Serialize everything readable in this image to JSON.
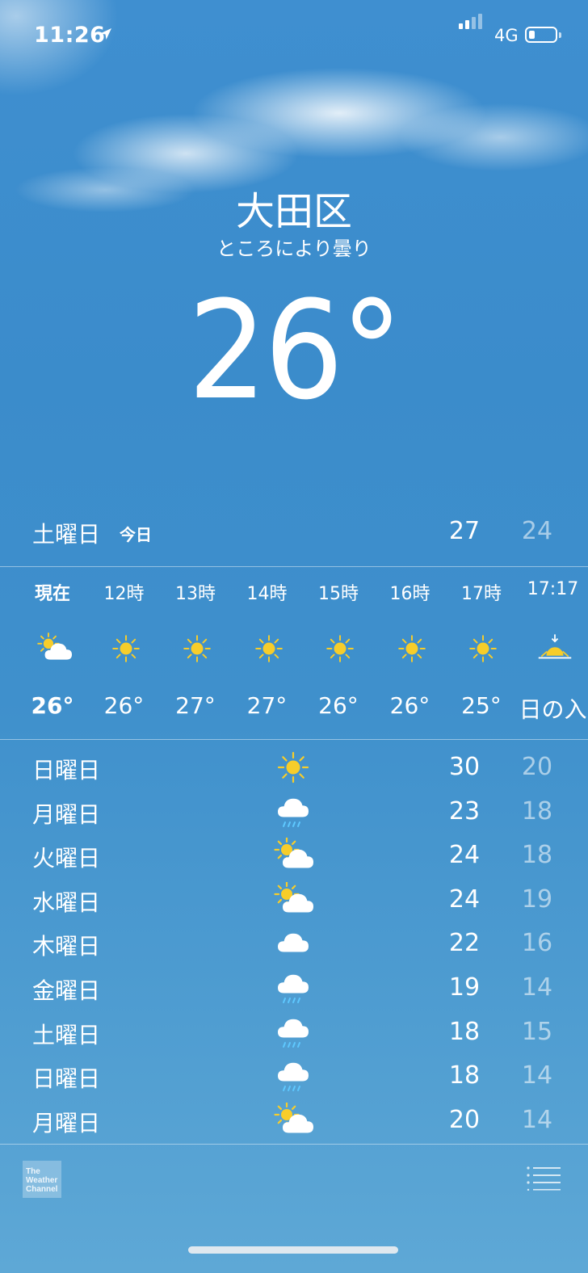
{
  "status_bar": {
    "time": "11:26",
    "network": "4G",
    "signal_bars": 2,
    "battery_level": 0.2
  },
  "header": {
    "city": "大田区",
    "condition": "ところにより曇り",
    "temperature": "26°"
  },
  "today": {
    "day": "土曜日",
    "tag": "今日",
    "high": "27",
    "low": "24"
  },
  "hourly": [
    {
      "label": "現在",
      "icon": "partly-cloudy-icon",
      "temp": "26°",
      "bold": true
    },
    {
      "label": "12時",
      "icon": "sun-icon",
      "temp": "26°"
    },
    {
      "label": "13時",
      "icon": "sun-icon",
      "temp": "27°"
    },
    {
      "label": "14時",
      "icon": "sun-icon",
      "temp": "27°"
    },
    {
      "label": "15時",
      "icon": "sun-icon",
      "temp": "26°"
    },
    {
      "label": "16時",
      "icon": "sun-icon",
      "temp": "26°"
    },
    {
      "label": "17時",
      "icon": "sun-icon",
      "temp": "25°"
    },
    {
      "label": "17:17",
      "icon": "sunset-icon",
      "temp": "日の入"
    }
  ],
  "daily": [
    {
      "day": "日曜日",
      "icon": "sun-icon",
      "high": "30",
      "low": "20"
    },
    {
      "day": "月曜日",
      "icon": "rain-icon",
      "high": "23",
      "low": "18"
    },
    {
      "day": "火曜日",
      "icon": "partly-cloudy-icon",
      "high": "24",
      "low": "18"
    },
    {
      "day": "水曜日",
      "icon": "partly-cloudy-icon",
      "high": "24",
      "low": "19"
    },
    {
      "day": "木曜日",
      "icon": "cloud-icon",
      "high": "22",
      "low": "16"
    },
    {
      "day": "金曜日",
      "icon": "rain-icon",
      "high": "19",
      "low": "14"
    },
    {
      "day": "土曜日",
      "icon": "rain-icon",
      "high": "18",
      "low": "15"
    },
    {
      "day": "日曜日",
      "icon": "rain-icon",
      "high": "18",
      "low": "14"
    },
    {
      "day": "月曜日",
      "icon": "partly-cloudy-icon",
      "high": "20",
      "low": "14"
    }
  ],
  "footer": {
    "provider_logo_text": [
      "The",
      "Weather",
      "Channel"
    ],
    "list_icon": "list-icon"
  },
  "colors": {
    "sun": "#f7cd2a",
    "rain": "#5ec8ff",
    "cloud": "#ffffff"
  }
}
